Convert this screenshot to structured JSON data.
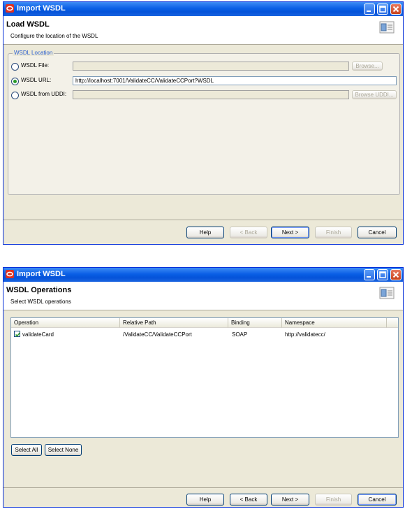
{
  "colors": {
    "titlebar": "#0553d9",
    "group_label": "#2a5ed1",
    "check_green": "#2a9a2a"
  },
  "dialog1": {
    "title": "Import WSDL",
    "header_title": "Load WSDL",
    "header_desc": "Configure the location of the WSDL",
    "group_label": "WSDL Location",
    "wsdl_file_label": "WSDL File:",
    "wsdl_file_value": "",
    "browse_label": "Browse...",
    "wsdl_url_label": "WSDL URL:",
    "wsdl_url_value": "http://localhost:7001/ValidateCC/ValidateCCPort?WSDL",
    "wsdl_uddi_label": "WSDL from UDDI:",
    "wsdl_uddi_value": "",
    "browse_uddi_label": "Browse UDDI...",
    "buttons": {
      "help": "Help",
      "back": "< Back",
      "next": "Next >",
      "finish": "Finish",
      "cancel": "Cancel"
    }
  },
  "dialog2": {
    "title": "Import WSDL",
    "header_title": "WSDL Operations",
    "header_desc": "Select WSDL operations",
    "columns": [
      "Operation",
      "Relative Path",
      "Binding",
      "Namespace"
    ],
    "rows": [
      {
        "checked": true,
        "operation": "validateCard",
        "path": "/ValidateCC/ValidateCCPort",
        "binding": "SOAP",
        "namespace": "http://validatecc/"
      }
    ],
    "select_all": "Select All",
    "select_none": "Select None",
    "buttons": {
      "help": "Help",
      "back": "< Back",
      "next": "Next >",
      "finish": "Finish",
      "cancel": "Cancel"
    }
  }
}
